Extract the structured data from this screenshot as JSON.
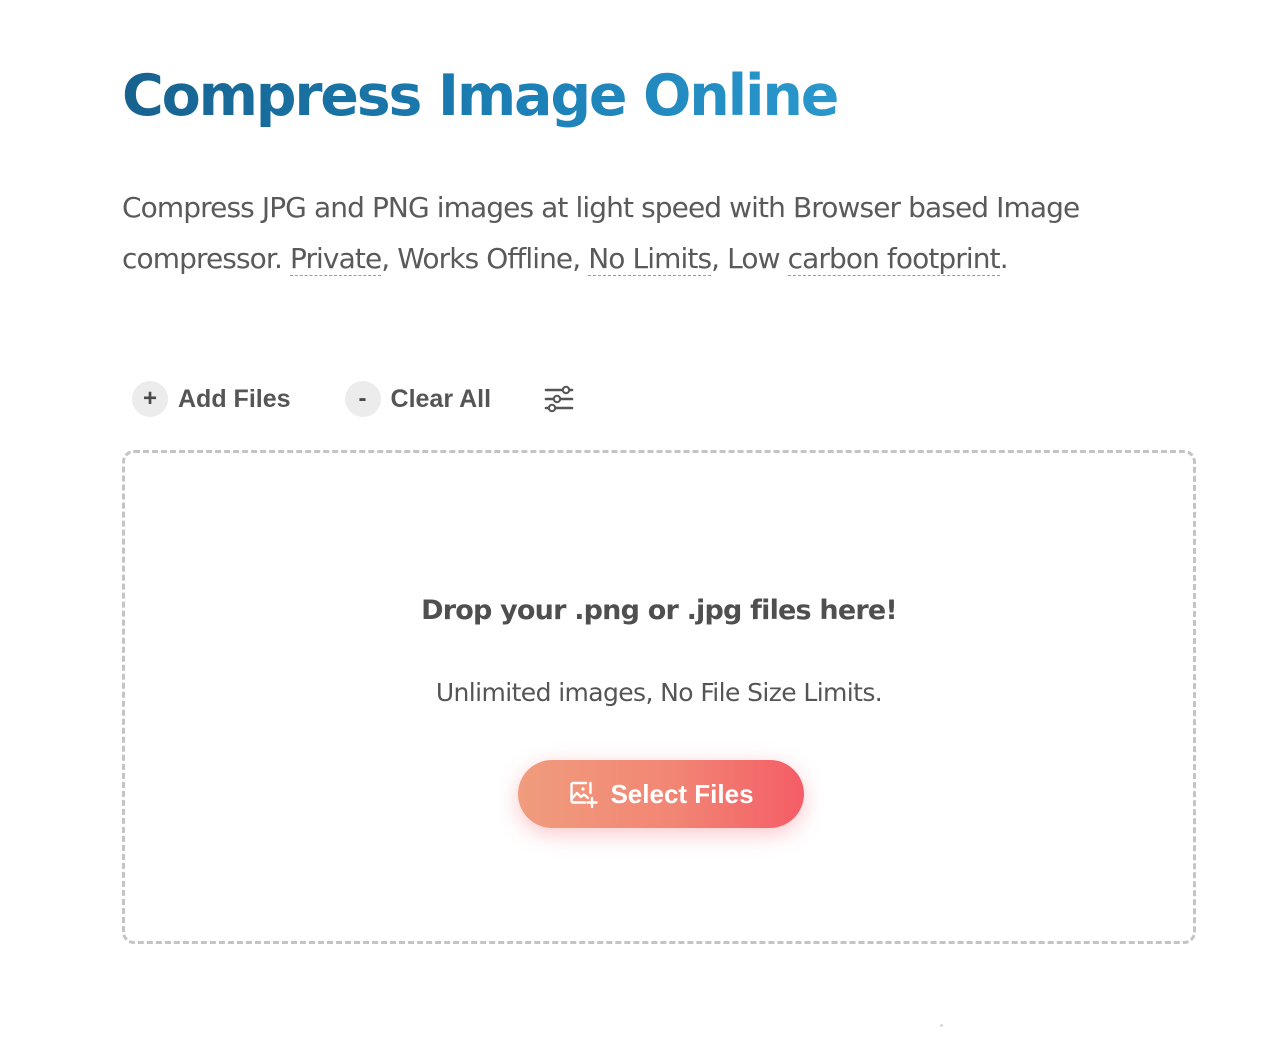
{
  "header": {
    "title": "Compress Image Online"
  },
  "intro": {
    "text_part1": "Compress JPG and PNG images at light speed with Browser based Image compressor. ",
    "feature_private": "Private",
    "sep1": ", Works Offline, ",
    "feature_no_limits": "No Limits",
    "sep2": ", Low ",
    "feature_carbon": "carbon footprint",
    "end": "."
  },
  "toolbar": {
    "add_files": {
      "icon": "plus-icon",
      "symbol": "+",
      "label": "Add Files"
    },
    "clear_all": {
      "icon": "minus-icon",
      "symbol": "-",
      "label": "Clear All"
    },
    "settings": {
      "icon": "sliders-icon"
    }
  },
  "dropzone": {
    "title": "Drop your .png or .jpg files here!",
    "subtitle": "Unlimited images, No File Size Limits.",
    "select_button": {
      "icon": "add-image-icon",
      "label": "Select Files"
    }
  },
  "colors": {
    "title_gradient_start": "#17628f",
    "title_gradient_end": "#2a98cd",
    "button_gradient_start": "#f09c7d",
    "button_gradient_end": "#f45d66",
    "text": "#555555",
    "dropzone_border": "#c4c4c4"
  }
}
